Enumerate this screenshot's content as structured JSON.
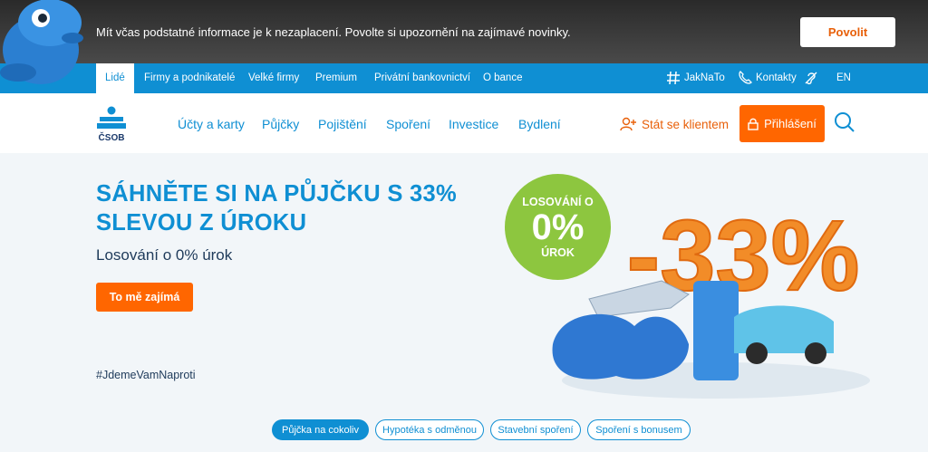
{
  "notification": {
    "text": "Mít včas podstatné informace je k nezaplacení. Povolte si upozornění na zajímavé novinky.",
    "button": "Povolit"
  },
  "topnav": {
    "segments": [
      "Lidé",
      "Firmy a podnikatelé",
      "Velké firmy",
      "Premium",
      "Privátní bankovnictví",
      "O bance"
    ],
    "right": {
      "jaknato": "JakNaTo",
      "contacts": "Kontakty",
      "language": "EN"
    }
  },
  "header": {
    "logo_text": "ČSOB",
    "nav": [
      "Účty a karty",
      "Půjčky",
      "Pojištění",
      "Spoření",
      "Investice",
      "Bydlení"
    ],
    "become_client": "Stát se klientem",
    "login": "Přihlášení"
  },
  "hero": {
    "title_line1": "SÁHNĚTE SI NA PŮJČKU S 33%",
    "title_line2": "SLEVOU Z ÚROKU",
    "subtitle": "Losování o 0% úrok",
    "cta": "To mě zajímá",
    "hashtag": "#JdemeVamNaproti",
    "badge": {
      "line1": "LOSOVÁNÍ O",
      "line2": "0%",
      "line3": "ÚROK"
    },
    "art_text": "-33%"
  },
  "pills": [
    {
      "label": "Půjčka na cokoliv",
      "active": true
    },
    {
      "label": "Hypotéka s odměnou",
      "active": false
    },
    {
      "label": "Stavební spoření",
      "active": false
    },
    {
      "label": "Spoření s bonusem",
      "active": false
    }
  ],
  "colors": {
    "brand_blue": "#0f8fd3",
    "orange": "#ff6600",
    "badge_green": "#8dc63f"
  }
}
